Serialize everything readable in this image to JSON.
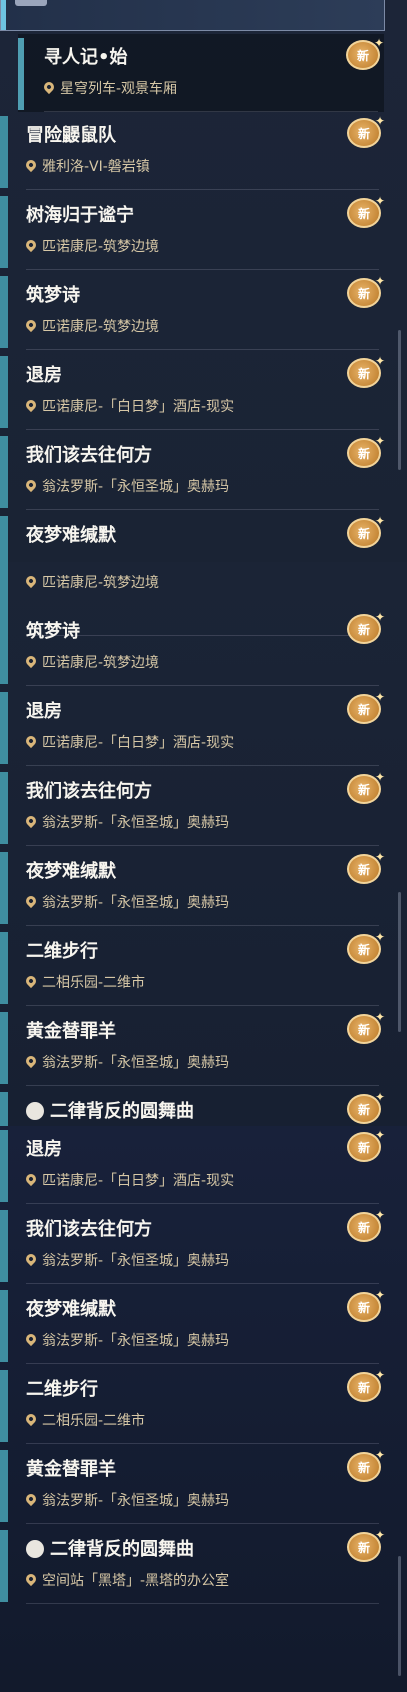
{
  "header": {
    "partial_label": ""
  },
  "badge_label": "新",
  "segment1": [
    {
      "title": "寻人记•始",
      "location": "星穹列车-观景车厢",
      "selected": true
    },
    {
      "title": "冒险鼹鼠队",
      "location": "雅利洛-VI-磐岩镇"
    },
    {
      "title": "树海归于谧宁",
      "location": "匹诺康尼-筑梦边境"
    },
    {
      "title": "筑梦诗",
      "location": "匹诺康尼-筑梦边境"
    },
    {
      "title": "退房",
      "location": "匹诺康尼-「白日梦」酒店-现实"
    },
    {
      "title": "我们该去往何方",
      "location": "翁法罗斯-「永恒圣城」奥赫玛"
    },
    {
      "title": "夜梦难缄默",
      "location": ""
    }
  ],
  "segment2": [
    {
      "title": "",
      "location": "匹诺康尼-筑梦边境"
    },
    {
      "title": "筑梦诗",
      "location": "匹诺康尼-筑梦边境"
    },
    {
      "title": "退房",
      "location": "匹诺康尼-「白日梦」酒店-现实"
    },
    {
      "title": "我们该去往何方",
      "location": "翁法罗斯-「永恒圣城」奥赫玛"
    },
    {
      "title": "夜梦难缄默",
      "location": "翁法罗斯-「永恒圣城」奥赫玛"
    },
    {
      "title": "二维步行",
      "location": "二相乐园-二维市"
    },
    {
      "title": "黄金替罪羊",
      "location": "翁法罗斯-「永恒圣城」奥赫玛"
    },
    {
      "title": "二律背反的圆舞曲",
      "location": "",
      "puzzle": true
    }
  ],
  "segment3": [
    {
      "title": "退房",
      "location": "匹诺康尼-「白日梦」酒店-现实"
    },
    {
      "title": "我们该去往何方",
      "location": "翁法罗斯-「永恒圣城」奥赫玛"
    },
    {
      "title": "夜梦难缄默",
      "location": "翁法罗斯-「永恒圣城」奥赫玛"
    },
    {
      "title": "二维步行",
      "location": "二相乐园-二维市"
    },
    {
      "title": "黄金替罪羊",
      "location": "翁法罗斯-「永恒圣城」奥赫玛"
    },
    {
      "title": "二律背反的圆舞曲",
      "location": "空间站「黑塔」-黑塔的办公室",
      "puzzle": true
    }
  ]
}
